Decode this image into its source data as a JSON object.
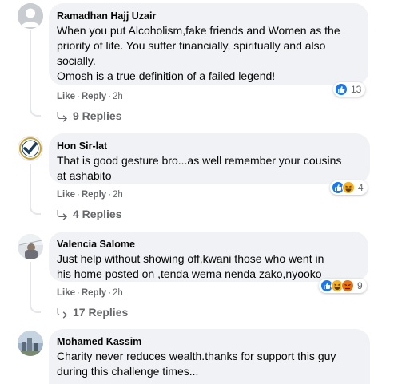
{
  "comments": [
    {
      "author": "Ramadhan Hajj Uzair",
      "text_lines": [
        "When you put Alcoholism,fake friends and Women as the",
        "priority of life. You suffer financially, spiritually and also",
        "socially.",
        "Omosh is a true definition of a failed legend!"
      ],
      "like_label": "Like",
      "reply_label": "Reply",
      "time": "2h",
      "reaction_count": "13",
      "reaction_icons": [
        "like-icon"
      ],
      "replies_label": "9 Replies",
      "avatar": "default-avatar-icon"
    },
    {
      "author": "Hon Sir-lat",
      "text_lines": [
        "That is good gesture bro...as well remember your cousins",
        "at ashabito"
      ],
      "like_label": "Like",
      "reply_label": "Reply",
      "time": "2h",
      "reaction_count": "4",
      "reaction_icons": [
        "like-icon",
        "haha-icon"
      ],
      "replies_label": "4 Replies",
      "avatar": "checkmark-logo-avatar"
    },
    {
      "author": "Valencia Salome",
      "text_lines": [
        "Just help without showing off,kwani those who went in",
        "his home posted on ,tenda wema nenda zako,nyooko"
      ],
      "like_label": "Like",
      "reply_label": "Reply",
      "time": "2h",
      "reaction_count": "9",
      "reaction_icons": [
        "like-icon",
        "haha-icon",
        "angry-icon"
      ],
      "replies_label": "17 Replies",
      "avatar": "photo-avatar"
    },
    {
      "author": "Mohamed Kassim",
      "text_lines": [
        "Charity never reduces wealth.thanks for support this guy",
        "during this challenge times..."
      ],
      "avatar": "photo-avatar"
    }
  ],
  "colors": {
    "bubble": "#f0f2f5",
    "secondary_text": "#65676b",
    "like_blue": "#1877f2",
    "haha_yellow": "#f7b125",
    "angry_orange": "#e9710f"
  }
}
